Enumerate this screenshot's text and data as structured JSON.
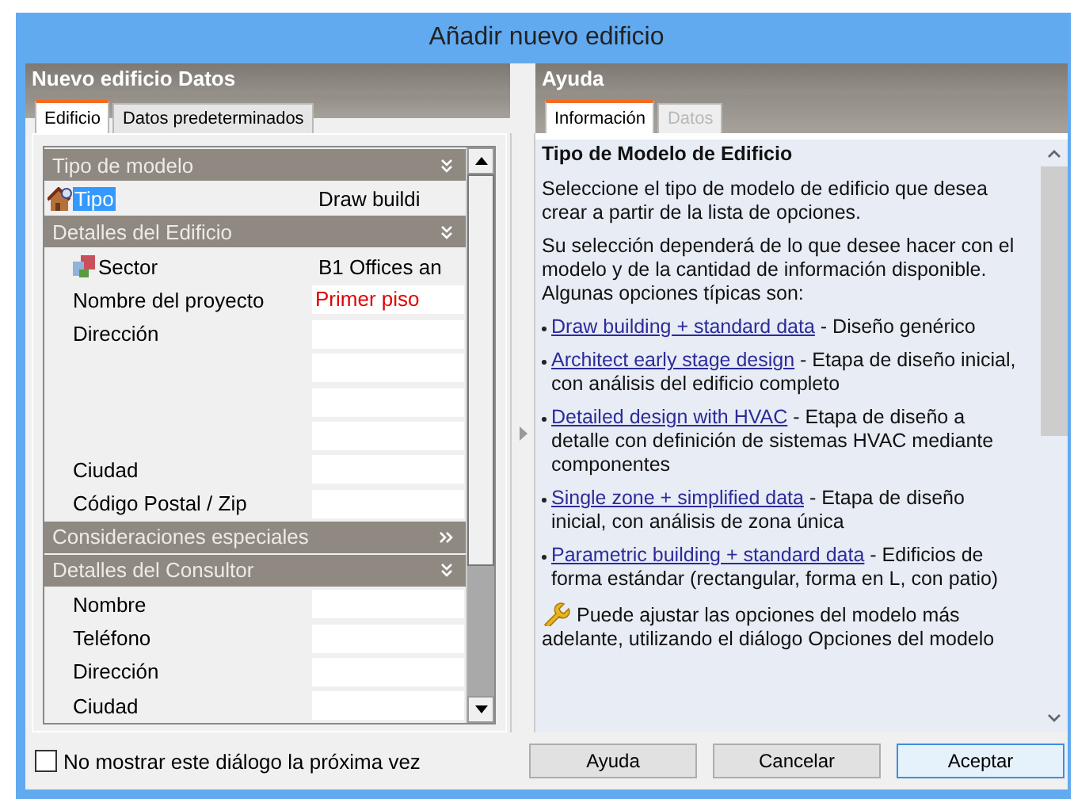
{
  "window": {
    "title": "Añadir nuevo edificio"
  },
  "left_panel": {
    "title": "Nuevo edificio Datos",
    "tabs": [
      {
        "label": "Edificio",
        "selected": true,
        "disabled": false
      },
      {
        "label": "Datos predeterminados",
        "selected": false,
        "disabled": false
      }
    ],
    "rows": [
      {
        "kind": "section",
        "label": "Tipo de modelo",
        "expanded": true
      },
      {
        "kind": "model-property",
        "label": "Tipo",
        "value": "Draw buildi",
        "selected": true,
        "flagged": false
      },
      {
        "kind": "section",
        "label": "Detalles del Edificio",
        "expanded": true
      },
      {
        "kind": "sector-property",
        "label": "Sector",
        "value": "B1 Offices an",
        "selected": false,
        "flagged": false
      },
      {
        "kind": "field",
        "label": "Nombre del proyecto",
        "value": "Primer piso",
        "selected": false,
        "flagged": true
      },
      {
        "kind": "field",
        "label": "Dirección",
        "selected": false
      },
      {
        "kind": "field"
      },
      {
        "kind": "field"
      },
      {
        "kind": "field"
      },
      {
        "kind": "field",
        "label": "Ciudad",
        "selected": false
      },
      {
        "kind": "field",
        "label": "Código Postal / Zip",
        "selected": false
      },
      {
        "kind": "section",
        "label": "Consideraciones especiales",
        "expanded": false
      },
      {
        "kind": "section",
        "label": "Detalles del Consultor",
        "expanded": true
      },
      {
        "kind": "field",
        "label": "Nombre",
        "selected": false
      },
      {
        "kind": "field",
        "label": "Teléfono",
        "selected": false
      },
      {
        "kind": "field",
        "label": "Dirección",
        "selected": false
      },
      {
        "kind": "field",
        "label": "Ciudad",
        "selected": false
      }
    ]
  },
  "help_panel": {
    "title": "Ayuda",
    "tabs": [
      {
        "label": "Información",
        "selected": true,
        "disabled": false
      },
      {
        "label": "Datos",
        "selected": false,
        "disabled": true
      }
    ],
    "heading": "Tipo de Modelo de Edificio",
    "paragraphs": [
      "Seleccione el tipo de modelo de edificio que desea crear a partir de la lista de opciones.",
      "Su selección dependerá de lo que desee hacer con el modelo y de la cantidad de información disponible. Algunas opciones típicas son:"
    ],
    "options": [
      {
        "link": "Draw building + standard data",
        "text": " - Diseño genérico"
      },
      {
        "link": "Architect early stage design",
        "text": " - Etapa de diseño inicial, con análisis del edificio completo"
      },
      {
        "link": "Detailed design with HVAC",
        "text": " - Etapa de diseño a detalle con definición de sistemas HVAC mediante componentes"
      },
      {
        "link": "Single zone + simplified data",
        "text": " - Etapa de diseño inicial, con análisis de zona única"
      },
      {
        "link": "Parametric building + standard data",
        "text": " - Edificios de forma estándar (rectangular, forma en L, con patio)"
      }
    ],
    "tip": "Puede ajustar las opciones del modelo más adelante, utilizando el diálogo Opciones del modelo"
  },
  "footer": {
    "checkbox": {
      "label": "No mostrar este diálogo la próxima vez",
      "checked": false
    },
    "buttons": [
      {
        "label": "Ayuda",
        "default": false
      },
      {
        "label": "Cancelar",
        "default": false
      },
      {
        "label": "Aceptar",
        "default": true
      }
    ]
  }
}
